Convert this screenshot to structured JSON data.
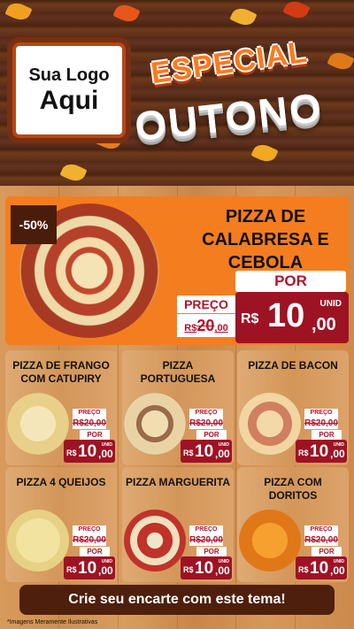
{
  "header": {
    "logo_line1": "Sua Logo",
    "logo_line2": "Aqui",
    "title_line1": "ESPECIAL",
    "title_line2": "OUTONO"
  },
  "featured": {
    "discount": "-50%",
    "name": "PIZZA DE CALABRESA E CEBOLA",
    "preco_label": "PREÇO",
    "old_cur": "R$",
    "old_int": "20",
    "old_dec": ",00",
    "por_label": "POR",
    "unid_label": "UNID",
    "cur": "R$",
    "int": "10",
    "dec": ",00"
  },
  "cards": [
    {
      "name": "PIZZA DE FRANGO COM CATUPIRY",
      "preco_label": "PREÇO",
      "old": "R$20,00",
      "por_label": "POR",
      "unid_label": "UNID",
      "cur": "R$",
      "int": "10",
      "dec": ",00"
    },
    {
      "name": "PIZZA PORTUGUESA",
      "preco_label": "PREÇO",
      "old": "R$20,00",
      "por_label": "POR",
      "unid_label": "UNID",
      "cur": "R$",
      "int": "10",
      "dec": ",00"
    },
    {
      "name": "PIZZA DE BACON",
      "preco_label": "PREÇO",
      "old": "R$20,00",
      "por_label": "POR",
      "unid_label": "UNID",
      "cur": "R$",
      "int": "10",
      "dec": ",00"
    },
    {
      "name": "PIZZA 4 QUEIJOS",
      "preco_label": "PREÇO",
      "old": "R$20,00",
      "por_label": "POR",
      "unid_label": "UNID",
      "cur": "R$",
      "int": "10",
      "dec": ",00"
    },
    {
      "name": "PIZZA MARGUERITA",
      "preco_label": "PREÇO",
      "old": "R$20,00",
      "por_label": "POR",
      "unid_label": "UNID",
      "cur": "R$",
      "int": "10",
      "dec": ",00"
    },
    {
      "name": "PIZZA COM DORITOS",
      "preco_label": "PREÇO",
      "old": "R$20,00",
      "por_label": "POR",
      "unid_label": "UNID",
      "cur": "R$",
      "int": "10",
      "dec": ",00"
    }
  ],
  "cta": "Crie seu encarte com este tema!",
  "footnote": "*Imagens Meramente Ilustrativas",
  "colors": {
    "accent_orange": "#f47d1f",
    "price_red": "#9e1324",
    "dark_brown": "#4e1f0d"
  }
}
